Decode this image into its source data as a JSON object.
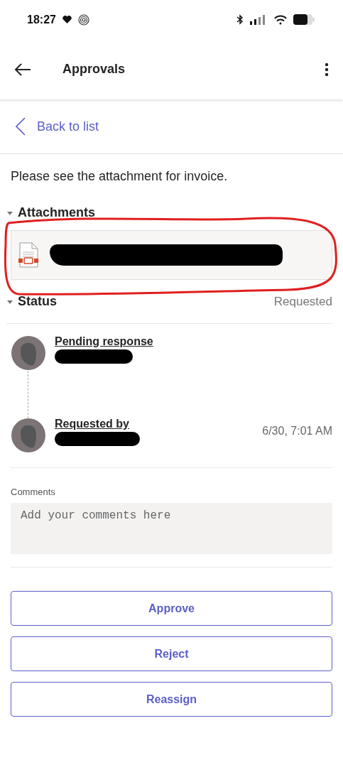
{
  "status_bar": {
    "time": "18:27"
  },
  "app_bar": {
    "title": "Approvals"
  },
  "back_link": {
    "label": "Back to list"
  },
  "message": "Please see the attachment for invoice.",
  "attachments": {
    "title": "Attachments",
    "expanded": true
  },
  "status": {
    "title": "Status",
    "expanded": true,
    "value": "Requested"
  },
  "timeline": [
    {
      "label": "Pending response"
    },
    {
      "label": "Requested by",
      "time": "6/30, 7:01 AM"
    }
  ],
  "comments": {
    "label": "Comments",
    "placeholder": "Add your comments here"
  },
  "buttons": [
    "Approve",
    "Reject",
    "Reassign"
  ]
}
